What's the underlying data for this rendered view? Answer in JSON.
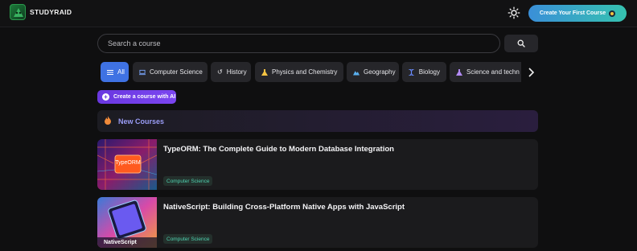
{
  "header": {
    "brand": "STUDYRAID",
    "cta_label": "Create Your First Course"
  },
  "search": {
    "placeholder": "Search a course"
  },
  "categories": [
    {
      "label": "All",
      "icon": "list-icon",
      "active": true
    },
    {
      "label": "Computer Science",
      "icon": "laptop-icon"
    },
    {
      "label": "History",
      "icon": "history-icon"
    },
    {
      "label": "Physics and Chemistry",
      "icon": "flask-icon"
    },
    {
      "label": "Geography",
      "icon": "mountains-icon"
    },
    {
      "label": "Biology",
      "icon": "dna-icon"
    },
    {
      "label": "Science and techn",
      "icon": "beaker-icon"
    }
  ],
  "ai_button": {
    "label": "Create a course with AI"
  },
  "section": {
    "title": "New Courses",
    "icon": "fire-icon"
  },
  "courses": [
    {
      "title": "TypeORM: The Complete Guide to Modern Database Integration",
      "tag": "Computer Science",
      "thumb_text": "TypeORM"
    },
    {
      "title": "NativeScript: Building Cross-Platform Native Apps with JavaScript",
      "tag": "Computer Science",
      "thumb_text": "NativeScript"
    }
  ],
  "colors": {
    "background": "#0f0f10",
    "accent_blue": "#3f72e3",
    "accent_purple": "#6a38e0",
    "tag_green": "#4fd1b0"
  }
}
